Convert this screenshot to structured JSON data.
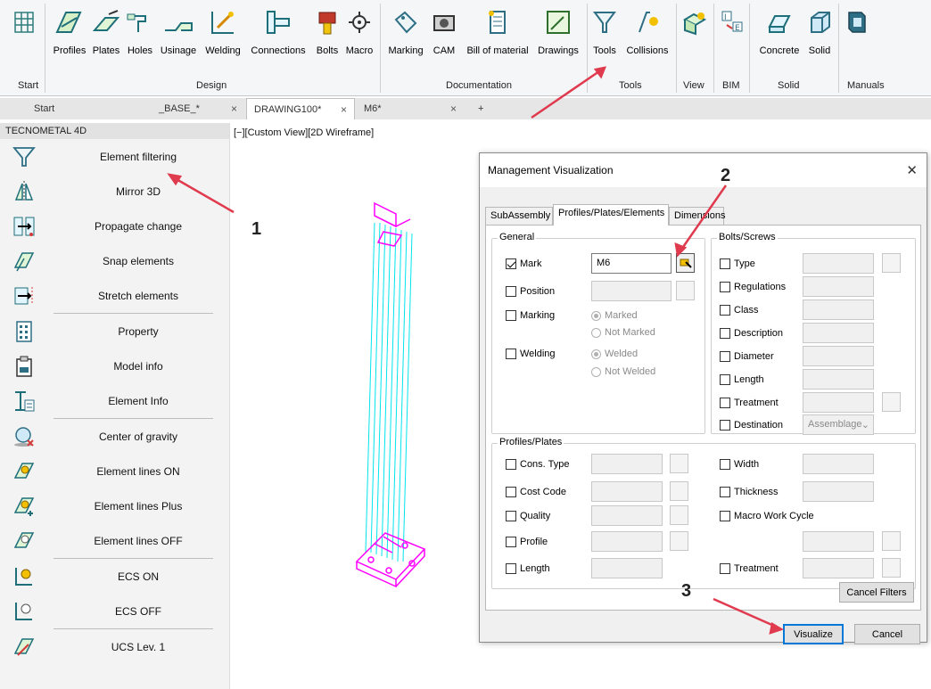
{
  "ribbon": {
    "buttons": {
      "start_icon_name": "start-grid-icon",
      "profiles": "Profiles",
      "plates": "Plates",
      "holes": "Holes",
      "usinage": "Usinage",
      "welding": "Welding",
      "connections": "Connections",
      "bolts": "Bolts",
      "macro": "Macro",
      "marking": "Marking",
      "cam": "CAM",
      "bill_of_material": "Bill of material",
      "drawings": "Drawings",
      "tools": "Tools",
      "collisions": "Collisions",
      "concrete": "Concrete",
      "solid": "Solid"
    },
    "groups": {
      "start": "Start",
      "design": "Design",
      "documentation": "Documentation",
      "tools": "Tools",
      "view": "View",
      "bim": "BIM",
      "solid": "Solid",
      "manuals": "Manuals"
    }
  },
  "tabs": [
    {
      "label": "Start"
    },
    {
      "label": "_BASE_*"
    },
    {
      "label": "DRAWING100*"
    },
    {
      "label": "M6*"
    }
  ],
  "tab_add": "+",
  "tab_close": "×",
  "panel": {
    "title": "TECNOMETAL 4D",
    "items": [
      {
        "label": "Element filtering"
      },
      {
        "label": "Mirror 3D"
      },
      {
        "label": "Propagate change"
      },
      {
        "label": "Snap elements"
      },
      {
        "label": "Stretch elements"
      },
      {
        "label": "Property"
      },
      {
        "label": "Model info"
      },
      {
        "label": "Element Info"
      },
      {
        "label": "Center of gravity"
      },
      {
        "label": "Element lines ON"
      },
      {
        "label": "Element lines Plus"
      },
      {
        "label": "Element lines OFF"
      },
      {
        "label": "ECS ON"
      },
      {
        "label": "ECS OFF"
      },
      {
        "label": "UCS Lev. 1"
      }
    ]
  },
  "viewport": {
    "label": "[−][Custom View][2D Wireframe]"
  },
  "dialog": {
    "title": "Management Visualization",
    "close": "✕",
    "tabs": [
      "SubAssembly",
      "Profiles/Plates/Elements",
      "Dimensions"
    ],
    "general": {
      "title": "General",
      "mark": {
        "label": "Mark",
        "value": "M6",
        "checked": true
      },
      "position": {
        "label": "Position"
      },
      "marking": {
        "label": "Marking",
        "opt1": "Marked",
        "opt2": "Not Marked"
      },
      "welding": {
        "label": "Welding",
        "opt1": "Welded",
        "opt2": "Not Welded"
      }
    },
    "bolts": {
      "title": "Bolts/Screws",
      "type": "Type",
      "regulations": "Regulations",
      "class": "Class",
      "description": "Description",
      "diameter": "Diameter",
      "length": "Length",
      "treatment": "Treatment",
      "destination": "Destination",
      "destination_value": "Assemblage"
    },
    "profiles": {
      "title": "Profiles/Plates",
      "cons_type": "Cons. Type",
      "cost_code": "Cost Code",
      "quality": "Quality",
      "profile": "Profile",
      "length": "Length",
      "width": "Width",
      "thickness": "Thickness",
      "macro_work_cycle": "Macro Work Cycle",
      "treatment": "Treatment"
    },
    "cancel_filters": "Cancel Filters",
    "visualize": "Visualize",
    "cancel": "Cancel"
  },
  "annotations": {
    "n1": "1",
    "n2": "2",
    "n3": "3",
    "arrow_color": "#e03a4e"
  },
  "colors": {
    "model": "#00e5ee",
    "model_accent": "#ff00ff",
    "default_button": "#0078d7"
  }
}
